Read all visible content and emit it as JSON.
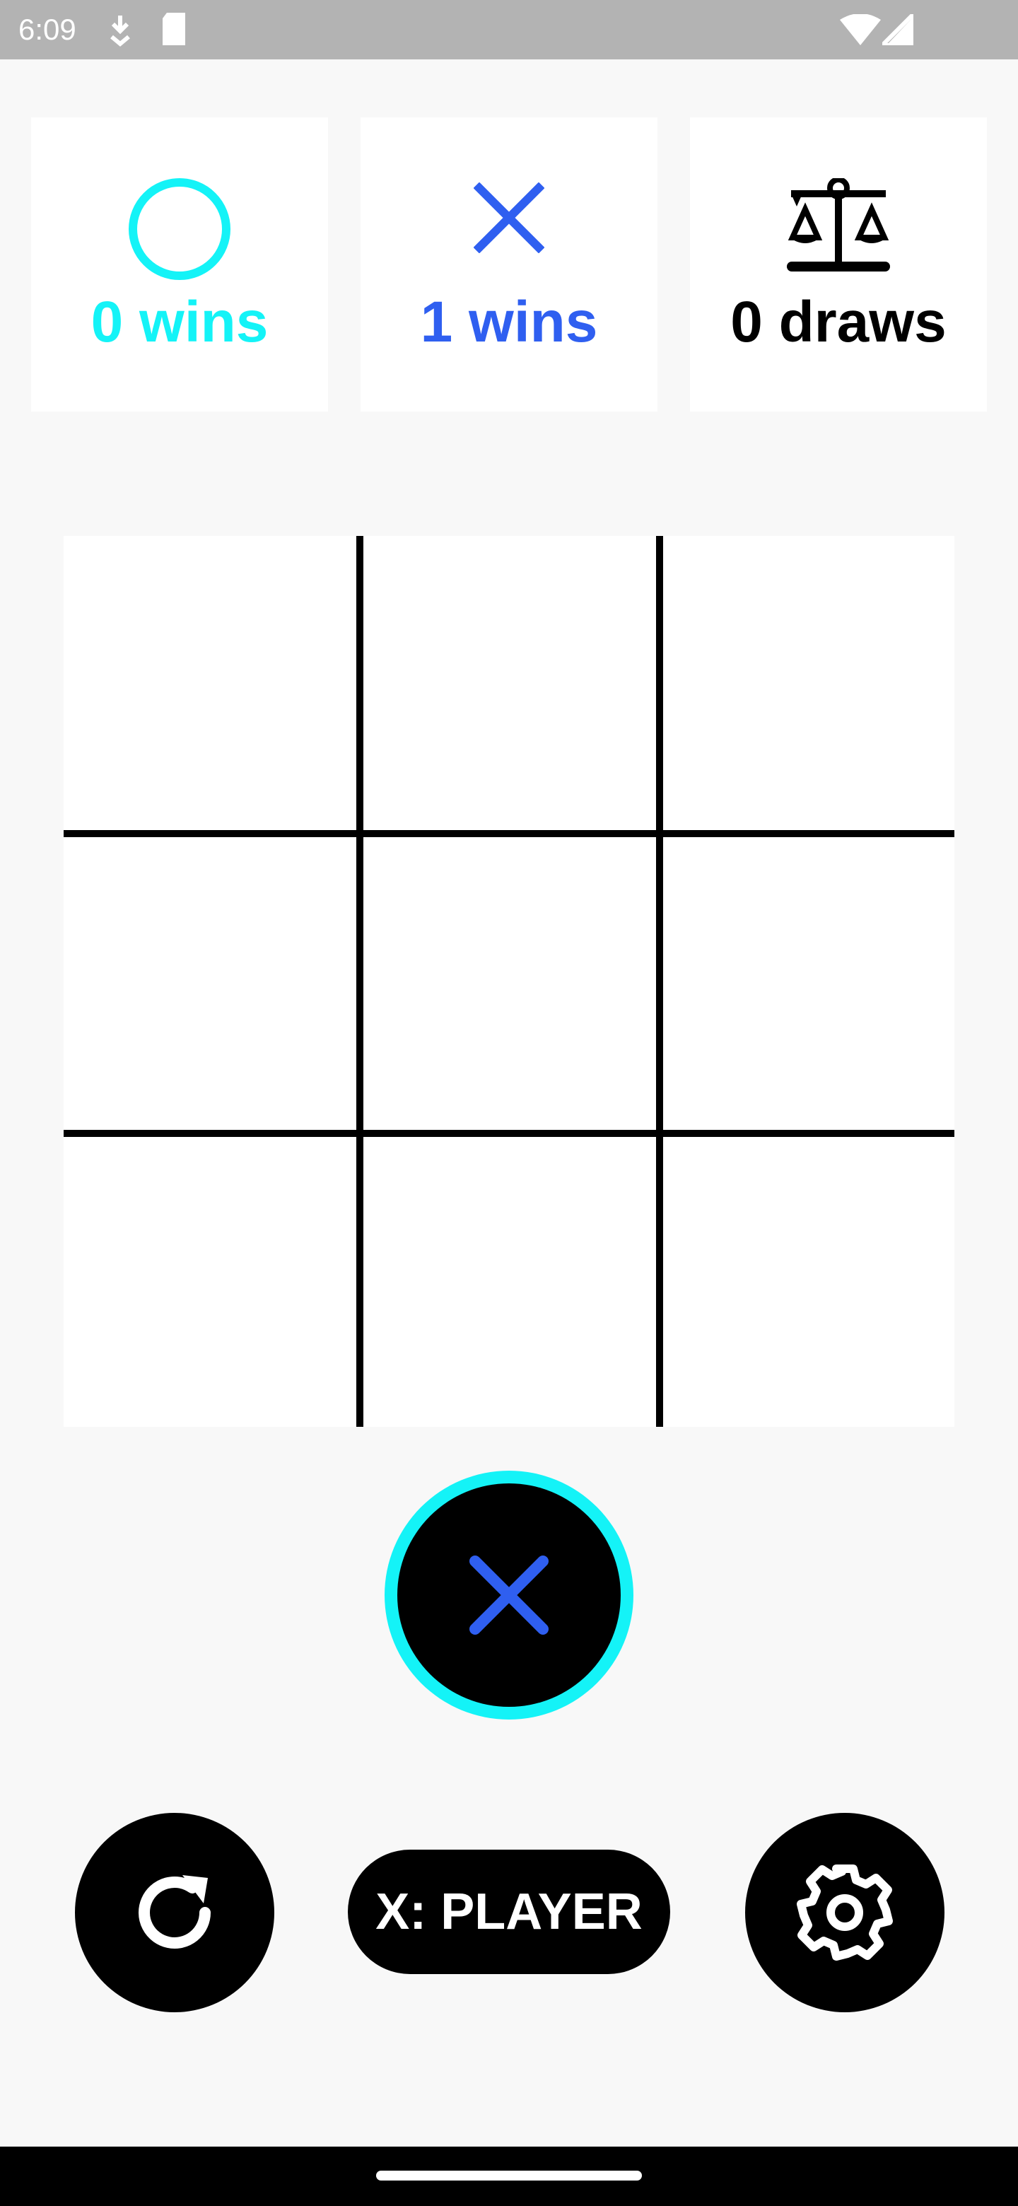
{
  "status_bar": {
    "time": "6:09",
    "icons": [
      "download-icon",
      "sd-card-icon",
      "wifi-icon",
      "signal-icon"
    ]
  },
  "scores": {
    "o": {
      "label": "0 wins",
      "icon": "circle-icon",
      "color": "#14f3f7"
    },
    "x": {
      "label": "1 wins",
      "icon": "cross-icon",
      "color": "#2f5ff0"
    },
    "draws": {
      "label": "0 draws",
      "icon": "balance-scale-icon",
      "color": "#000000"
    }
  },
  "board": {
    "cells": [
      "",
      "",
      "",
      "",
      "",
      "",
      "",
      "",
      ""
    ]
  },
  "turn": {
    "current": "X",
    "icon": "cross-icon",
    "ring_color": "#14f3f7"
  },
  "controls": {
    "restart_icon": "restart-icon",
    "mode_label": "X: PLAYER",
    "settings_icon": "gear-icon"
  }
}
